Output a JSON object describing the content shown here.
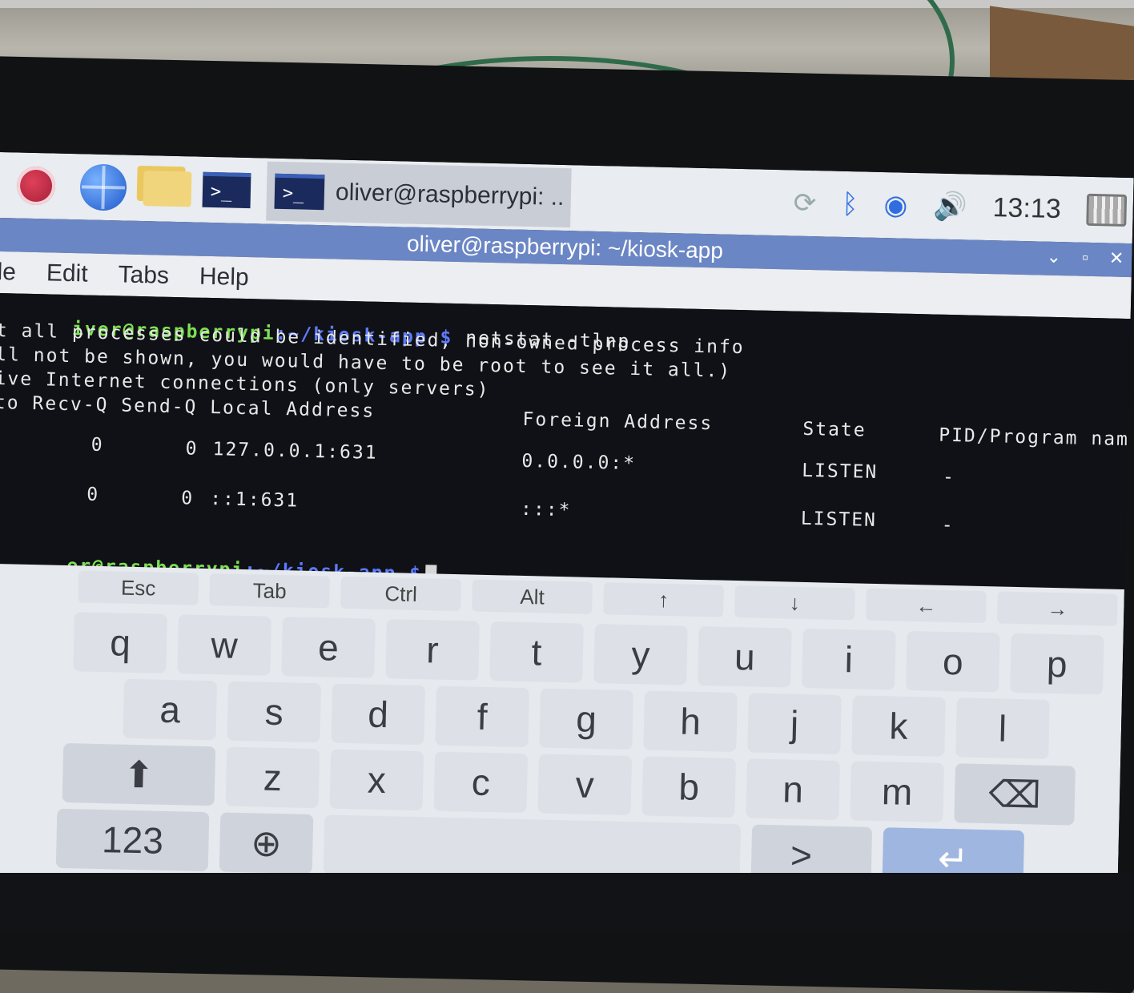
{
  "taskbar": {
    "task_label": "oliver@raspberrypi: ..",
    "clock": "13:13",
    "terminal_glyph": ">_"
  },
  "window": {
    "title": "oliver@raspberrypi: ~/kiosk-app",
    "menu": [
      "le",
      "Edit",
      "Tabs",
      "Help"
    ]
  },
  "terminal": {
    "prompt_user": "iver@raspberrypi",
    "prompt_path": ":~/kiosk-app $",
    "command": " netstat -tlnp",
    "lines": [
      "t all processes could be identified, non-owned process info",
      "ll not be shown, you would have to be root to see it all.)",
      "ive Internet connections (only servers)"
    ],
    "header": {
      "c1": "to Recv-Q Send-Q Local Address",
      "foreign": "Foreign Address",
      "state": "State",
      "pid": "PID/Program name"
    },
    "rows": [
      {
        "recvq": "0",
        "sendq": "0",
        "local": "127.0.0.1:631",
        "foreign": "0.0.0.0:*",
        "state": "LISTEN",
        "pid": "-"
      },
      {
        "recvq": "0",
        "sendq": "0",
        "local": "::1:631",
        "foreign": ":::*",
        "state": "LISTEN",
        "pid": "-"
      }
    ],
    "final_prompt_user": "er@raspberrypi",
    "final_prompt_path": ":~/kiosk-app $"
  },
  "keyboard": {
    "modifiers": [
      "Esc",
      "Tab",
      "Ctrl",
      "Alt",
      "↑",
      "↓",
      "←",
      "→"
    ],
    "row1": [
      "q",
      "w",
      "e",
      "r",
      "t",
      "y",
      "u",
      "i",
      "o",
      "p"
    ],
    "row2": [
      "a",
      "s",
      "d",
      "f",
      "g",
      "h",
      "j",
      "k",
      "l"
    ],
    "row3": [
      "z",
      "x",
      "c",
      "v",
      "b",
      "n",
      "m"
    ],
    "shift": "⬆",
    "backspace": "⌫",
    "numbers": "123",
    "globe": "⊕",
    "terminal": ">_",
    "enter": "↵"
  }
}
